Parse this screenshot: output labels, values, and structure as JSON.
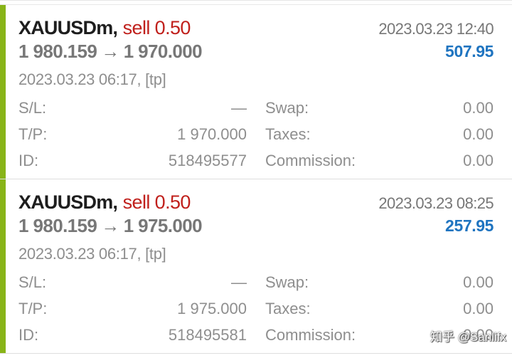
{
  "colors": {
    "accent_bar": "#88b418",
    "sell": "#c0201c",
    "profit": "#1f74c0",
    "symbol": "#1e1e1e",
    "muted": "#8e8e8e"
  },
  "trades": [
    {
      "symbol": "XAUUSDm,",
      "type_volume": "sell 0.50",
      "open_price": "1 980.159",
      "arrow": "→",
      "close_price": "1 970.000",
      "close_time": "2023.03.23 12:40",
      "profit": "507.95",
      "open_info": "2023.03.23 06:17, [tp]",
      "sl_label": "S/L:",
      "sl_value": "—",
      "tp_label": "T/P:",
      "tp_value": "1 970.000",
      "id_label": "ID:",
      "id_value": "518495577",
      "swap_label": "Swap:",
      "swap_value": "0.00",
      "taxes_label": "Taxes:",
      "taxes_value": "0.00",
      "commission_label": "Commission:",
      "commission_value": "0.00"
    },
    {
      "symbol": "XAUUSDm,",
      "type_volume": "sell 0.50",
      "open_price": "1 980.159",
      "arrow": "→",
      "close_price": "1 975.000",
      "close_time": "2023.03.23 08:25",
      "profit": "257.95",
      "open_info": "2023.03.23 06:17, [tp]",
      "sl_label": "S/L:",
      "sl_value": "—",
      "tp_label": "T/P:",
      "tp_value": "1 975.000",
      "id_label": "ID:",
      "id_value": "518495581",
      "swap_label": "Swap:",
      "swap_value": "0.00",
      "taxes_label": "Taxes:",
      "taxes_value": "0.00",
      "commission_label": "Commission:",
      "commission_value": "0.00"
    }
  ],
  "watermark": "知乎 @Sanlifx"
}
